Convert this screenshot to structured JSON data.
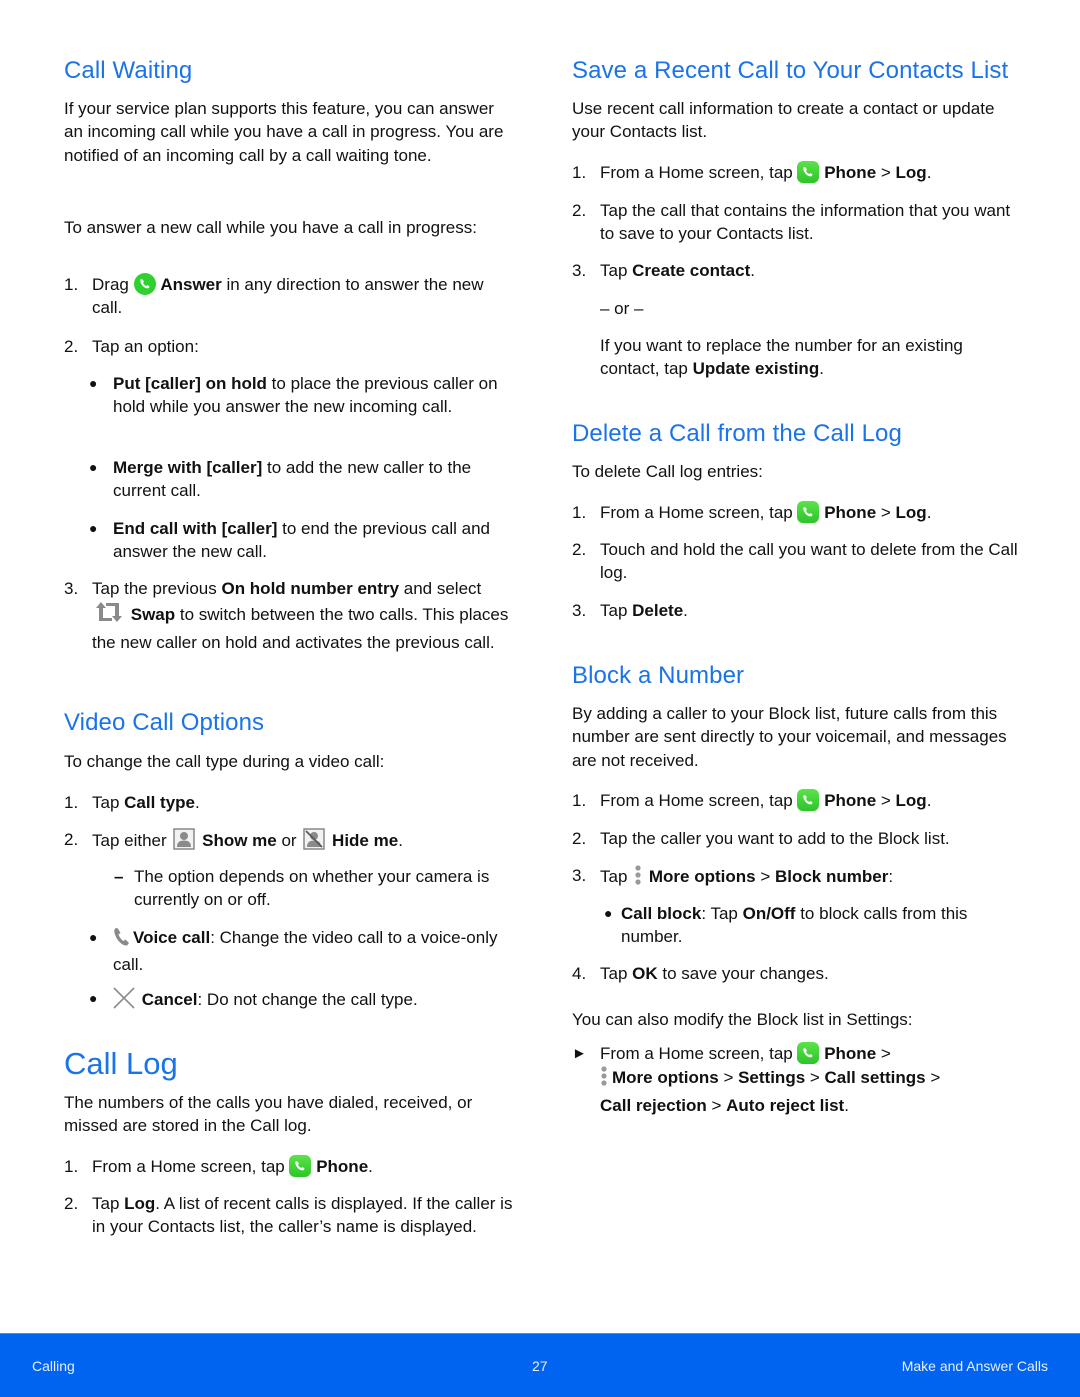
{
  "left": {
    "call_waiting": {
      "heading": "Call Waiting",
      "intro": "If your service plan supports this feature, you can answer an incoming call while you have a call in progress. You are notified of an incoming call by a call waiting tone.",
      "lead": "To answer a new call while you have a call in progress:",
      "step1": {
        "num": "1.",
        "pre": "Drag",
        "bold": "Answer",
        "post": " in any direction to answer the new call."
      },
      "step2": {
        "num": "2.",
        "text": "Tap an option:"
      },
      "options": [
        {
          "bold": "Put [caller] on hold",
          "text": " to place the previous caller on hold while you answer the new incoming call."
        },
        {
          "bold": "Merge with [caller]",
          "text": " to add the new caller to the current call."
        },
        {
          "bold": "End call with [caller]",
          "text": " to end the previous call and answer the new call."
        }
      ],
      "step3": {
        "num": "3.",
        "pre": "Tap the previous ",
        "bold1": "On hold number entry",
        "mid": " and select ",
        "bold2": "Swap",
        "post": " to switch between the two calls. This places the new caller on hold and activates the previous call."
      }
    },
    "video_call": {
      "heading": "Video Call Options",
      "lead": "To change the call type during a video call:",
      "step1": {
        "num": "1.",
        "pre": "Tap ",
        "bold": "Call type",
        "post": "."
      },
      "step2": {
        "num": "2.",
        "pre": "Tap either ",
        "bold1": "Show me",
        "mid": " or ",
        "bold2": "Hide me",
        "post": "."
      },
      "note": {
        "dash": "–",
        "text": "The option depends on whether your camera is currently on or off."
      },
      "options": [
        {
          "bold": "Voice call",
          "text": ": Change the video call to a voice-only call."
        },
        {
          "bold": "Cancel",
          "text": ": Do not change the call type."
        }
      ]
    },
    "call_log": {
      "heading": "Call Log",
      "intro": "The numbers of the calls you have dialed, received, or missed are stored in the Call log.",
      "step1": {
        "num": "1.",
        "pre": "From a Home screen, tap ",
        "bold": "Phone",
        "post": "."
      },
      "step2": {
        "num": "2.",
        "pre": "Tap ",
        "bold": "Log",
        "post": ". A list of recent calls is displayed. If the caller is in your Contacts list, the caller’s name is displayed."
      }
    }
  },
  "right": {
    "save_recent": {
      "heading": "Save a Recent Call to Your Contacts List",
      "intro": "Use recent call information to create a contact or update your Contacts list.",
      "step1": {
        "num": "1.",
        "pre": "From a Home screen, tap ",
        "bold1": "Phone",
        "sep": " > ",
        "bold2": "Log",
        "post": "."
      },
      "step2": {
        "num": "2.",
        "text": "Tap the call that contains the information that you want to save to your Contacts list."
      },
      "step3": {
        "num": "3.",
        "pre": "Tap ",
        "bold": "Create contact",
        "post": "."
      },
      "or": "– or –",
      "alt": {
        "pre": "If you want to replace the number for an existing contact, tap ",
        "bold": "Update existing",
        "post": "."
      }
    },
    "delete_call": {
      "heading": "Delete a Call from the Call Log",
      "lead": "To delete Call log entries:",
      "step1": {
        "num": "1.",
        "pre": "From a Home screen, tap ",
        "bold1": "Phone",
        "sep": " > ",
        "bold2": "Log",
        "post": "."
      },
      "step2": {
        "num": "2.",
        "text": "Touch and hold the call you want to delete from the Call log."
      },
      "step3": {
        "num": "3.",
        "pre": "Tap ",
        "bold": "Delete",
        "post": "."
      }
    },
    "block_number": {
      "heading": "Block a Number",
      "intro": "By adding a caller to your Block list, future calls from this number are sent directly to your voicemail, and messages are not received.",
      "step1": {
        "num": "1.",
        "pre": "From a Home screen, tap ",
        "bold1": "Phone",
        "sep": " > ",
        "bold2": "Log",
        "post": "."
      },
      "step2": {
        "num": "2.",
        "text": "Tap the caller you want to add to the Block list."
      },
      "step3": {
        "num": "3.",
        "pre": "Tap ",
        "bold1": "More options",
        "sep": " > ",
        "bold2": "Block number",
        "post": ":"
      },
      "option": {
        "bold1": "Call block",
        "mid": ": Tap ",
        "bold2": "On/Off",
        "post": " to block calls from this number."
      },
      "step4": {
        "num": "4.",
        "pre": "Tap ",
        "bold": "OK",
        "post": " to save your changes."
      },
      "settings_lead": "You can also modify the Block list in Settings:",
      "settings_step": {
        "arrow": "►",
        "pre": "From a Home screen, tap ",
        "b1": "Phone",
        "s1": " >",
        "b2": "More options",
        "s2": " > ",
        "b3": "Settings",
        "s3": " > ",
        "b4": "Call settings",
        "s4": " >",
        "b5": "Call rejection",
        "s5": " > ",
        "b6": "Auto reject list",
        "post": "."
      }
    }
  },
  "footer": {
    "section": "Calling",
    "page": "27",
    "chapter": "Make and Answer Calls"
  },
  "colors": {
    "heading": "#1a73e8",
    "footer_bg": "#0064f0",
    "phone_icon": "#2bc52a",
    "icon_gray": "#888888"
  }
}
